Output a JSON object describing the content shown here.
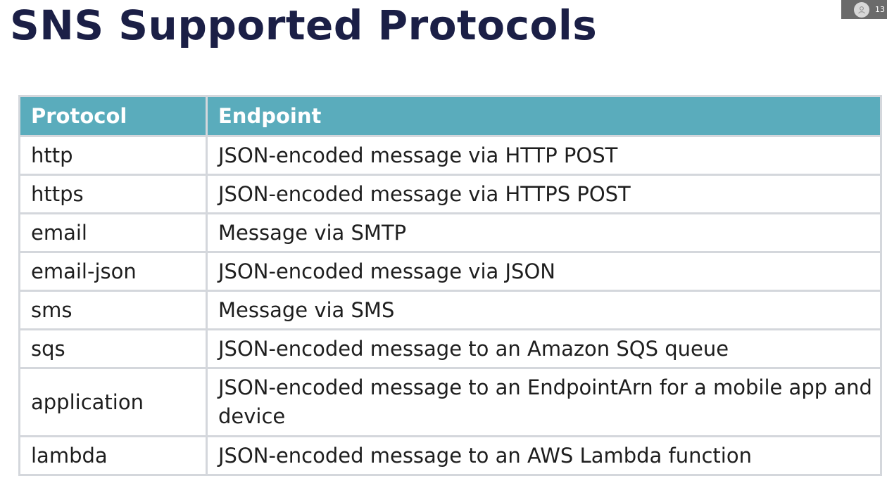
{
  "slide": {
    "title": "SNS Supported Protocols"
  },
  "presenter_badge": {
    "text": "13"
  },
  "table": {
    "headers": {
      "protocol": "Protocol",
      "endpoint": "Endpoint"
    },
    "rows": [
      {
        "protocol": "http",
        "endpoint": "JSON-encoded message via HTTP POST"
      },
      {
        "protocol": "https",
        "endpoint": "JSON-encoded message via HTTPS POST"
      },
      {
        "protocol": "email",
        "endpoint": "Message via SMTP"
      },
      {
        "protocol": "email-json",
        "endpoint": "JSON-encoded message via JSON"
      },
      {
        "protocol": "sms",
        "endpoint": "Message via SMS"
      },
      {
        "protocol": "sqs",
        "endpoint": "JSON-encoded message to an Amazon SQS queue"
      },
      {
        "protocol": "application",
        "endpoint": "JSON-encoded message to an EndpointArn for a mobile app and device"
      },
      {
        "protocol": "lambda",
        "endpoint": "JSON-encoded message to an AWS Lambda function"
      }
    ]
  },
  "colors": {
    "title": "#1b1f46",
    "header_background": "#5aacbc",
    "header_text": "#ffffff",
    "grid": "#d4d7dc",
    "badge_background": "#6b6b6b"
  },
  "icons": {
    "presenter": "person-icon"
  }
}
